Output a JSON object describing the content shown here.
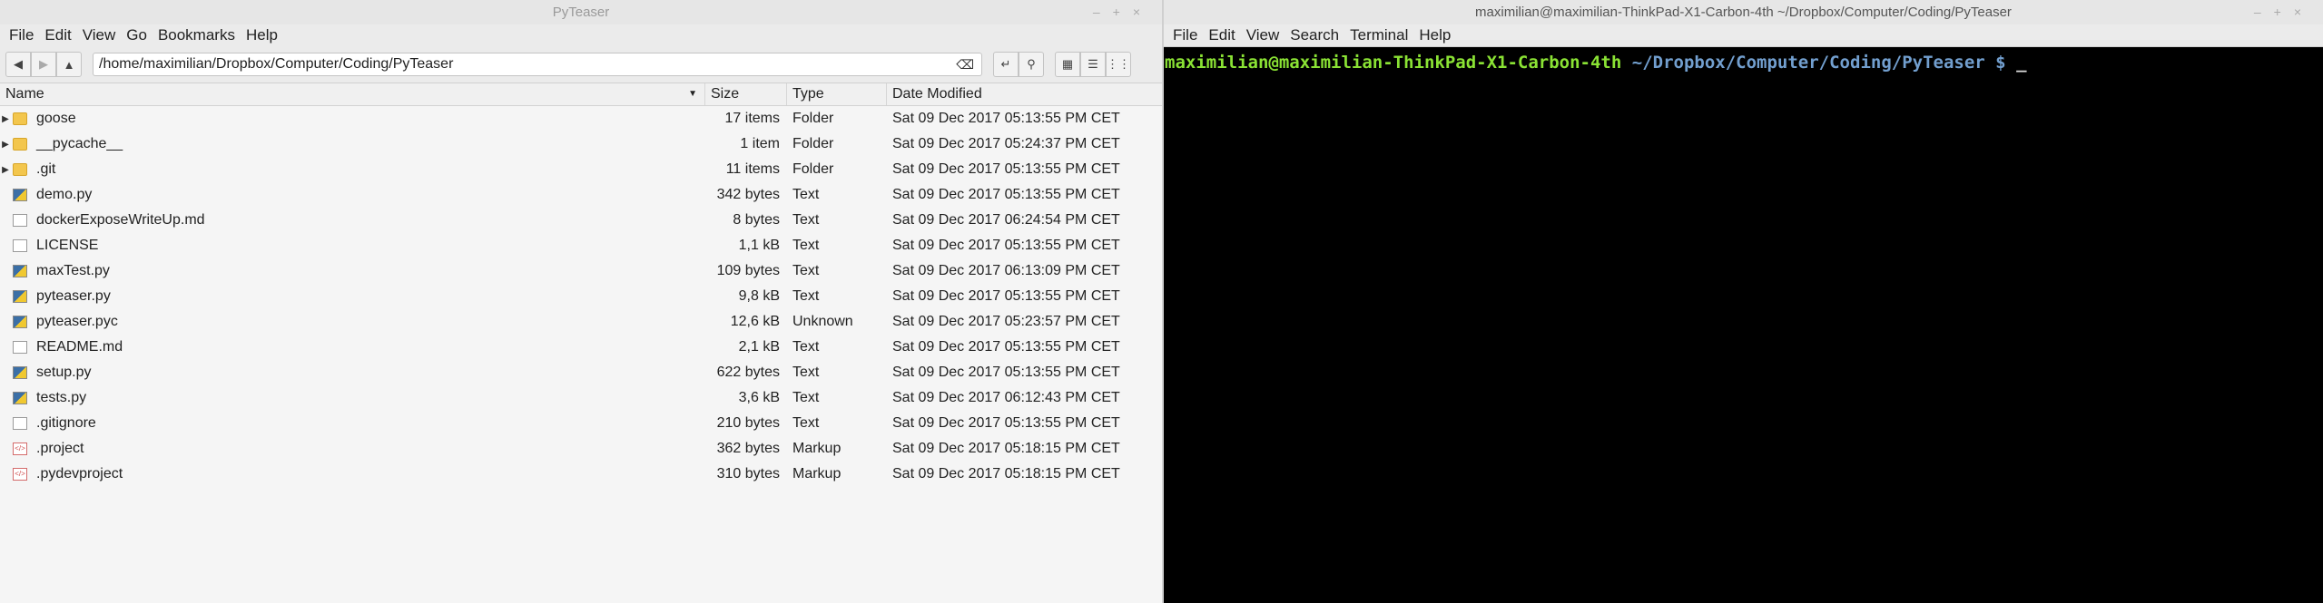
{
  "file_manager": {
    "title": "PyTeaser",
    "window_controls": [
      "–",
      "+",
      "×"
    ],
    "menu": [
      "File",
      "Edit",
      "View",
      "Go",
      "Bookmarks",
      "Help"
    ],
    "path": "/home/maximilian/Dropbox/Computer/Coding/PyTeaser",
    "columns": {
      "name": "Name",
      "size": "Size",
      "type": "Type",
      "date": "Date Modified"
    },
    "rows": [
      {
        "name": "goose",
        "size": "17 items",
        "type": "Folder",
        "date": "Sat 09 Dec 2017 05:13:55 PM CET",
        "icon": "folder-icon",
        "expandable": true
      },
      {
        "name": "__pycache__",
        "size": "1 item",
        "type": "Folder",
        "date": "Sat 09 Dec 2017 05:24:37 PM CET",
        "icon": "folder-icon",
        "expandable": true
      },
      {
        "name": ".git",
        "size": "11 items",
        "type": "Folder",
        "date": "Sat 09 Dec 2017 05:13:55 PM CET",
        "icon": "folder-icon",
        "expandable": true
      },
      {
        "name": "demo.py",
        "size": "342 bytes",
        "type": "Text",
        "date": "Sat 09 Dec 2017 05:13:55 PM CET",
        "icon": "python-file-icon",
        "expandable": false
      },
      {
        "name": "dockerExposeWriteUp.md",
        "size": "8 bytes",
        "type": "Text",
        "date": "Sat 09 Dec 2017 06:24:54 PM CET",
        "icon": "text-file-icon",
        "expandable": false
      },
      {
        "name": "LICENSE",
        "size": "1,1 kB",
        "type": "Text",
        "date": "Sat 09 Dec 2017 05:13:55 PM CET",
        "icon": "text-file-icon",
        "expandable": false
      },
      {
        "name": "maxTest.py",
        "size": "109 bytes",
        "type": "Text",
        "date": "Sat 09 Dec 2017 06:13:09 PM CET",
        "icon": "python-file-icon",
        "expandable": false
      },
      {
        "name": "pyteaser.py",
        "size": "9,8 kB",
        "type": "Text",
        "date": "Sat 09 Dec 2017 05:13:55 PM CET",
        "icon": "python-file-icon",
        "expandable": false
      },
      {
        "name": "pyteaser.pyc",
        "size": "12,6 kB",
        "type": "Unknown",
        "date": "Sat 09 Dec 2017 05:23:57 PM CET",
        "icon": "python-file-icon",
        "expandable": false
      },
      {
        "name": "README.md",
        "size": "2,1 kB",
        "type": "Text",
        "date": "Sat 09 Dec 2017 05:13:55 PM CET",
        "icon": "text-file-icon",
        "expandable": false
      },
      {
        "name": "setup.py",
        "size": "622 bytes",
        "type": "Text",
        "date": "Sat 09 Dec 2017 05:13:55 PM CET",
        "icon": "python-file-icon",
        "expandable": false
      },
      {
        "name": "tests.py",
        "size": "3,6 kB",
        "type": "Text",
        "date": "Sat 09 Dec 2017 06:12:43 PM CET",
        "icon": "python-file-icon",
        "expandable": false
      },
      {
        "name": ".gitignore",
        "size": "210 bytes",
        "type": "Text",
        "date": "Sat 09 Dec 2017 05:13:55 PM CET",
        "icon": "text-file-icon",
        "expandable": false
      },
      {
        "name": ".project",
        "size": "362 bytes",
        "type": "Markup",
        "date": "Sat 09 Dec 2017 05:18:15 PM CET",
        "icon": "markup-file-icon",
        "expandable": false
      },
      {
        "name": ".pydevproject",
        "size": "310 bytes",
        "type": "Markup",
        "date": "Sat 09 Dec 2017 05:18:15 PM CET",
        "icon": "markup-file-icon",
        "expandable": false
      }
    ]
  },
  "terminal": {
    "title": "maximilian@maximilian-ThinkPad-X1-Carbon-4th ~/Dropbox/Computer/Coding/PyTeaser",
    "window_controls": [
      "–",
      "+",
      "×"
    ],
    "menu": [
      "File",
      "Edit",
      "View",
      "Search",
      "Terminal",
      "Help"
    ],
    "prompt_user": "maximilian@maximilian-ThinkPad-X1-Carbon-4th",
    "prompt_path": "~/Dropbox/Computer/Coding/PyTeaser",
    "prompt_symbol": "$",
    "cursor": "_"
  }
}
